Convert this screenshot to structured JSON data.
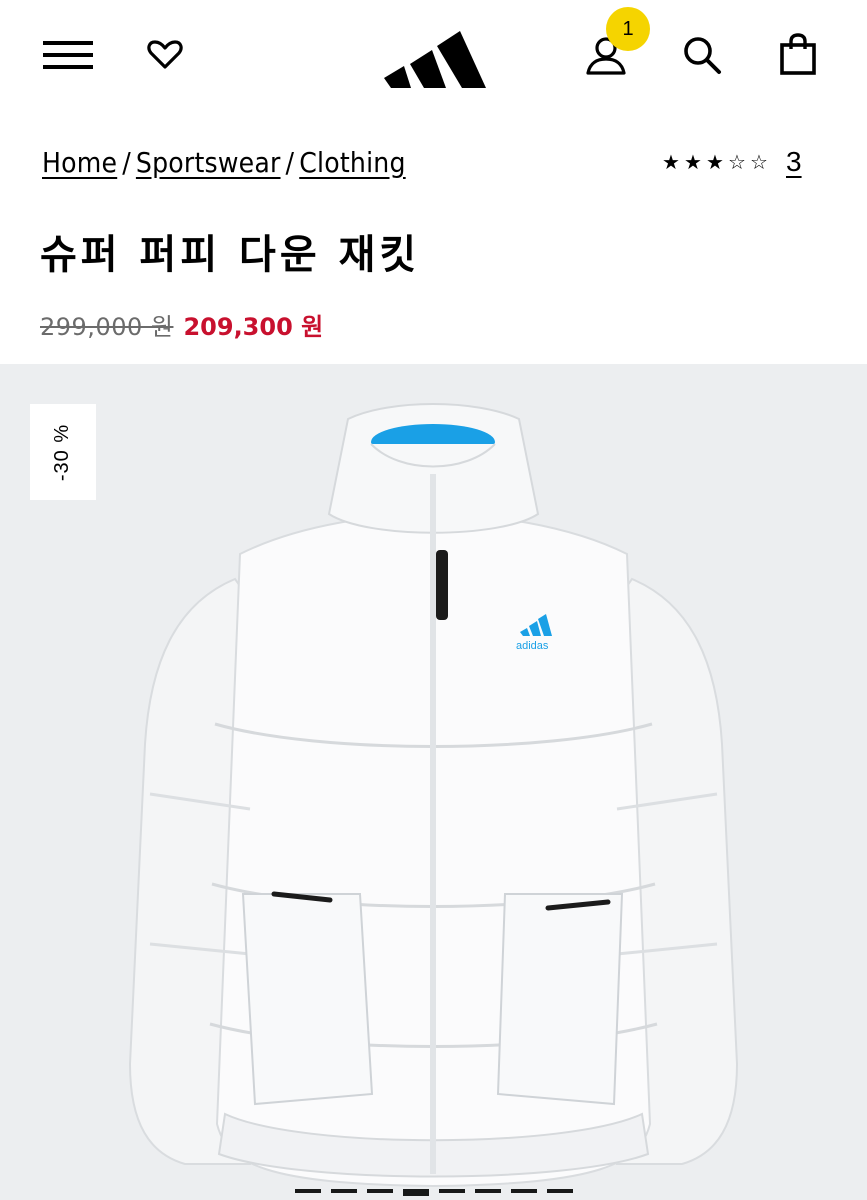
{
  "header": {
    "menu_icon": "hamburger-menu-icon",
    "wishlist_icon": "heart-icon",
    "logo": "adidas-performance-logo",
    "account_icon": "user-icon",
    "account_badge": "1",
    "search_icon": "search-icon",
    "bag_icon": "shopping-bag-icon",
    "badge_color": "#f5d400"
  },
  "breadcrumb": {
    "items": [
      "Home",
      "Sportswear",
      "Clothing"
    ],
    "separator": "/"
  },
  "rating": {
    "stars_filled": 3,
    "stars_total": 5,
    "count": "3"
  },
  "product": {
    "title": "슈퍼 퍼피 다운 재킷",
    "original_price": "299,000 원",
    "sale_price": "209,300 원",
    "sale_color": "#c8102e",
    "discount_badge": "-30 %"
  },
  "gallery": {
    "image": "white-puffer-down-jacket-photo",
    "background": "#eceef0",
    "slide_count": 8,
    "active_slide": 4
  }
}
